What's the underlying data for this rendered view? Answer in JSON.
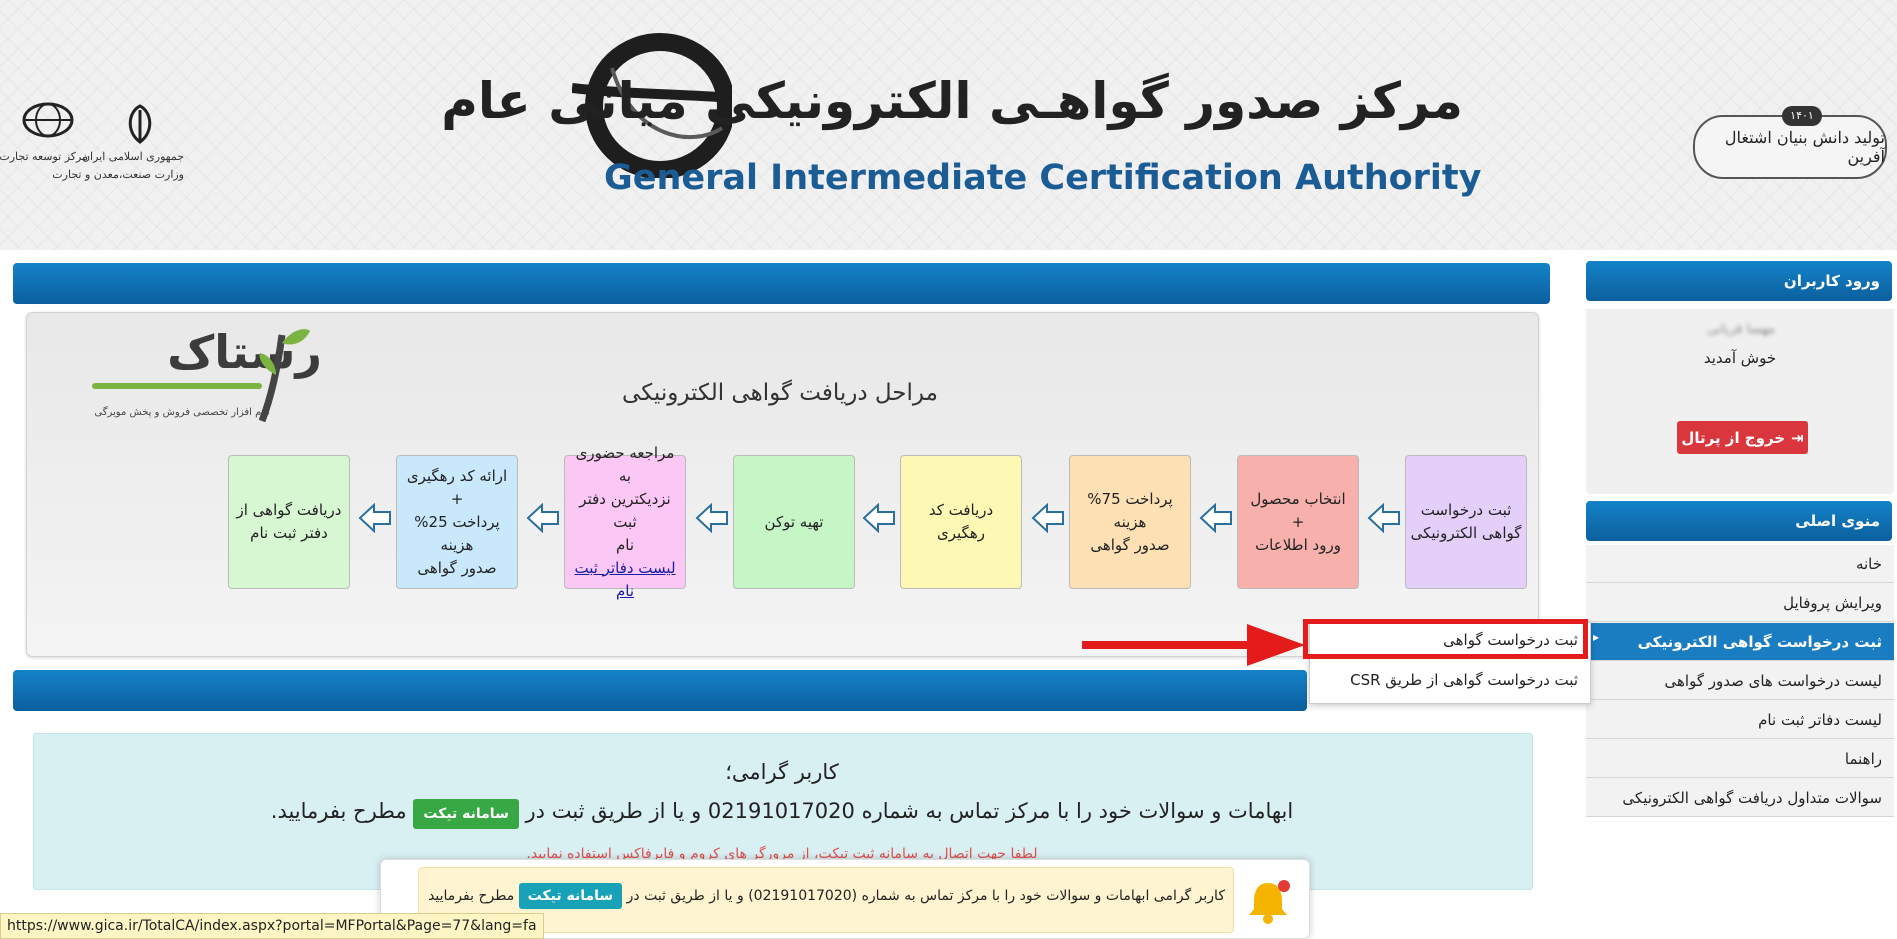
{
  "header": {
    "title_fa": "مرکز صدور گواهـی الکترونیکی میانی عام",
    "title_en": "General Intermediate Certification Authority",
    "slogan": "تولید دانش بنیان اشتغال آفرین",
    "slogan_year": "۱۴۰۱",
    "emblem_left_1": "مرکز توسعه تجارت الکترونیکی",
    "emblem_left_2": "جمهوری اسلامی ایران",
    "emblem_left_3": "وزارت صنعت،معدن و تجارت"
  },
  "main": {
    "logo_text": "رستاک",
    "logo_sub": "نرم افزار تخصصی فروش و پخش مویرگی",
    "panel_title": "مراحل دریافت گواهی الکترونیکی",
    "steps": [
      {
        "lines": [
          "ثبت درخواست",
          "گواهی الکترونیکی"
        ],
        "color": "#e4cffa"
      },
      {
        "lines": [
          "انتخاب محصول",
          "+",
          "ورود اطلاعات"
        ],
        "color": "#f8b0ad"
      },
      {
        "lines": [
          "پرداخت 75% هزینه",
          "صدور گواهی"
        ],
        "color": "#fde0b4"
      },
      {
        "lines": [
          "دریافت کد",
          "رهگیری"
        ],
        "color": "#fdf8b4"
      },
      {
        "lines": [
          "تهیه توکن"
        ],
        "color": "#c6f5c6"
      },
      {
        "lines": [
          "مراجعه حضوری به",
          "نزدیکترین دفتر ثبت",
          "نام"
        ],
        "link": "لیست دفاتر ثبت نام",
        "color": "#fbc8f5"
      },
      {
        "lines": [
          "ارائه کد رهگیری",
          "+",
          "پرداخت 25% هزینه",
          "صدور گواهی"
        ],
        "color": "#c9e8fb"
      },
      {
        "lines": [
          "دریافت گواهی از",
          "دفتر ثبت نام"
        ],
        "color": "#d6f7d2"
      }
    ]
  },
  "dropdown": {
    "item1": "ثبت درخواست گواهی",
    "item2": "ثبت درخواست گواهی از طریق CSR"
  },
  "info": {
    "greeting": "کاربر گرامی؛",
    "msg_part1": "ابهامات و سوالات خود را با مرکز تماس به شماره 02191017020 و یا از طریق ثبت در",
    "ticket_label": "سامانه تیکت",
    "msg_part2": "مطرح بفرمایید.",
    "note": "لطفا جهت اتصال به سامانه ثبت تیکت، از مرورگر های کروم و فایرفاکس استفاده نمایید."
  },
  "notification": {
    "msg_part1": "کاربر گرامی ابهامات و سوالات خود را با مرکز تماس به شماره (02191017020) و یا از طریق ثبت در",
    "ticket_label": "سامانه تیکت",
    "msg_part2": "مطرح بفرمایید"
  },
  "sidebar": {
    "login_header": "ورود کاربران",
    "user_name": "مهسا قربانی",
    "welcome": "خوش آمدید",
    "logout_label": "خروج از پرتال",
    "menu_header": "منوی اصلی",
    "menu_items": [
      "خانه",
      "ویرایش پروفایل",
      "ثبت درخواست گواهی الکترونیکی",
      "لیست درخواست های صدور گواهی",
      "لیست دفاتر ثبت نام",
      "راهنما",
      "سوالات متداول دریافت گواهی الکترونیکی"
    ]
  },
  "statusbar": {
    "url": "https://www.gica.ir/TotalCA/index.aspx?portal=MFPortal&Page=77&lang=fa"
  },
  "colors": {
    "primary_blue": "#0d6aaf",
    "active_menu": "#1a7cc1",
    "logout_red": "#d9363e",
    "ticket_green": "#38a845",
    "ticket_teal": "#17a2b8",
    "annotation_red": "#e31b1b"
  }
}
